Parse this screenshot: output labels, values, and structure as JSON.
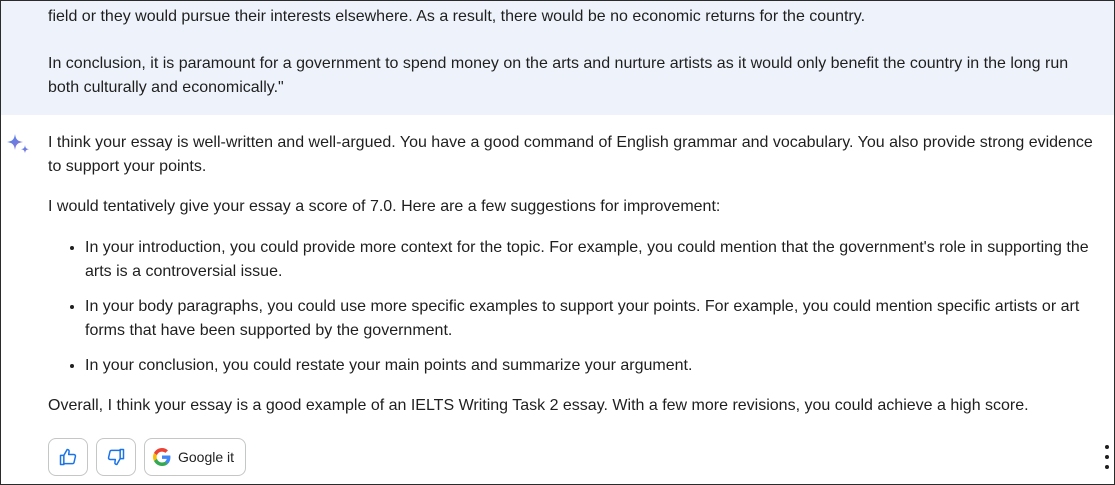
{
  "user_message": {
    "line_1": "field or they would pursue their interests elsewhere. As a result, there would be no economic returns for the country.",
    "line_2": " In conclusion, it is paramount for a government to spend money on the arts and nurture artists as it would only benefit the country in the long run both culturally and economically.\""
  },
  "response": {
    "icon": "sparkle-icon",
    "paragraph_1": "I think your essay is well-written and well-argued. You have a good command of English grammar and vocabulary. You also provide strong evidence to support your points.",
    "paragraph_2": "I would tentatively give your essay a score of 7.0. Here are a few suggestions for improvement:",
    "bullets": [
      "In your introduction, you could provide more context for the topic. For example, you could mention that the government's role in supporting the arts is a controversial issue.",
      "In your body paragraphs, you could use more specific examples to support your points. For example, you could mention specific artists or art forms that have been supported by the government.",
      "In your conclusion, you could restate your main points and summarize your argument."
    ],
    "paragraph_3": "Overall, I think your essay is a good example of an IELTS Writing Task 2 essay. With a few more revisions, you could achieve a high score."
  },
  "actions": {
    "thumbs_up_icon": "thumbs-up-icon",
    "thumbs_down_icon": "thumbs-down-icon",
    "google_it_label": "Google it",
    "more_icon": "more-vertical-icon"
  },
  "colors": {
    "user_bg": "#eef3fb",
    "accent_blue": "#1a73e8",
    "text": "#1f1f1f",
    "border": "#c4c7c5"
  }
}
